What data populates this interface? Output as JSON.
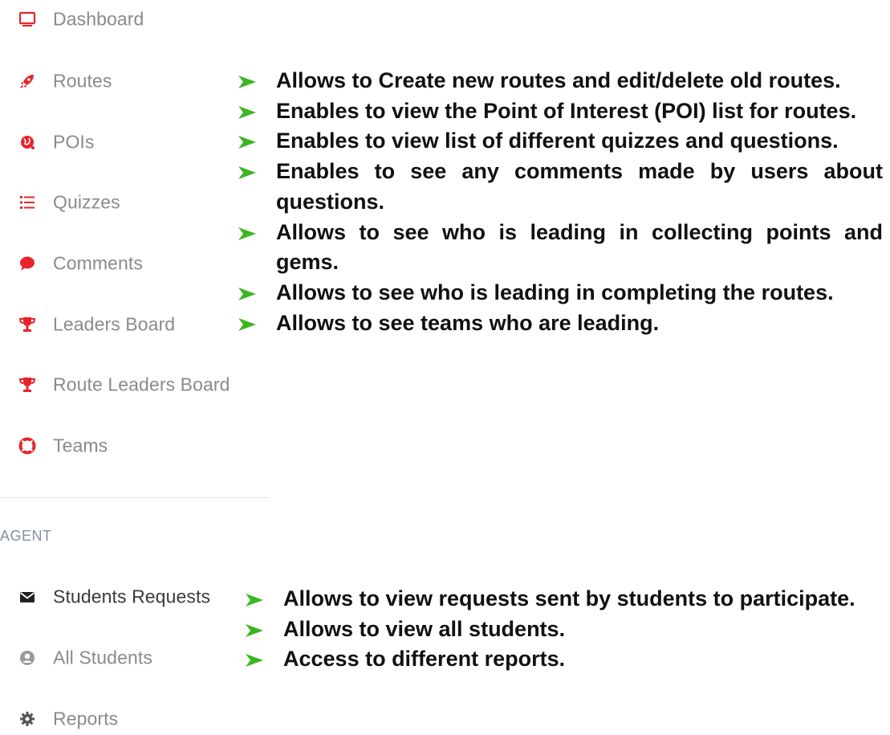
{
  "sidebar": {
    "items": [
      {
        "label": "Dashboard",
        "icon": "monitor-icon",
        "color": "#e5252a"
      },
      {
        "label": "Routes",
        "icon": "rocket-icon",
        "color": "#e5252a"
      },
      {
        "label": "POIs",
        "icon": "globe-icon",
        "color": "#e5252a"
      },
      {
        "label": "Quizzes",
        "icon": "list-icon",
        "color": "#e5252a"
      },
      {
        "label": "Comments",
        "icon": "comment-bubble-icon",
        "color": "#e5252a"
      },
      {
        "label": "Leaders Board",
        "icon": "trophy-icon",
        "color": "#e5252a"
      },
      {
        "label": "Route Leaders Board",
        "icon": "trophy-icon",
        "color": "#e5252a"
      },
      {
        "label": "Teams",
        "icon": "lifebuoy-icon",
        "color": "#e5252a"
      }
    ],
    "agent_heading": "AGENT",
    "agent_items": [
      {
        "label": "Students Requests",
        "icon": "envelope-icon",
        "color": "#222222"
      },
      {
        "label": "All Students",
        "icon": "user-circle-icon",
        "color": "#9a9a9a"
      },
      {
        "label": "Reports",
        "icon": "gear-icon",
        "color": "#555555"
      }
    ]
  },
  "descriptions": {
    "main": [
      "Allows to Create new routes and edit/delete old routes.",
      "Enables to view the Point of Interest (POI) list for routes.",
      "Enables to view list of different quizzes and questions.",
      "Enables to see any comments made by users about questions.",
      "Allows to see who is leading in collecting points and gems.",
      "Allows to see who is leading in completing the routes.",
      "Allows to see teams who are leading."
    ],
    "agent": [
      "Allows to view requests sent by students to participate.",
      "Allows to view all students.",
      "Access to different reports."
    ]
  },
  "colors": {
    "accent": "#e5252a",
    "bullet_arrow": "#3cb521",
    "label_gray": "#8a8a8a",
    "section_heading": "#7f8fa3"
  }
}
